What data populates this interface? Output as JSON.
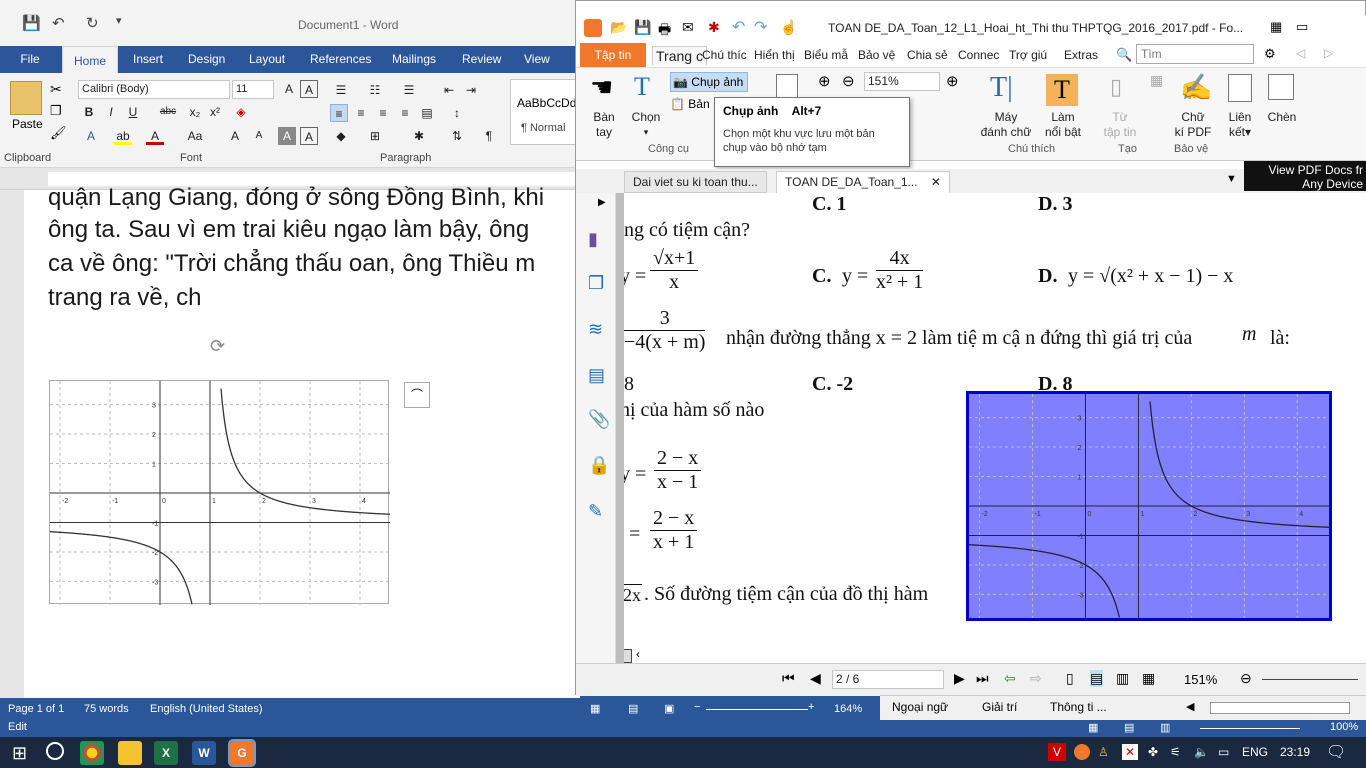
{
  "word": {
    "title": "Document1  -  Word",
    "tabs": [
      "File",
      "Home",
      "Insert",
      "Design",
      "Layout",
      "References",
      "Mailings",
      "Review",
      "View"
    ],
    "font_name": "Calibri (Body)",
    "font_size": "11",
    "style_preview": "AaBbCcDd",
    "style_name": "¶ Normal",
    "paste_label": "Paste",
    "groups": [
      "Clipboard",
      "Font",
      "Paragraph"
    ],
    "doc_lines": [
      "quận Lạng Giang, đóng ở sông Đồng Bình, khi",
      "ông ta. Sau vì em trai kiêu ngạo làm bậy, ông",
      "ca về ông: \"Trời chẳng thấu oan, ông Thiều m",
      "trang ra về, ch"
    ],
    "status": {
      "page": "Page 1 of 1",
      "words": "75 words",
      "lang": "English (United States)",
      "zoom": "164%"
    },
    "edit": "Edit"
  },
  "foxit": {
    "title": "TOAN DE_DA_Toan_12_L1_Hoai_ht_Thi thu THPTQG_2016_2017.pdf - Fo...",
    "tabs": [
      "Tập tin",
      "Trang c",
      "Chú thíc",
      "Hiển thị",
      "Biểu mẫ",
      "Bảo vệ",
      "Chia sẻ",
      "Connec",
      "Trợ giú",
      "Extras"
    ],
    "search_placeholder": "Tìm",
    "ribbon": {
      "hand": [
        "Bàn",
        "tay"
      ],
      "select": "Chọn",
      "snapshot": "Chụp ảnh",
      "clipboard": "Bản",
      "zoom": "151%",
      "typewriter": [
        "Máy",
        "đánh chữ"
      ],
      "highlight": [
        "Làm",
        "nổi bật"
      ],
      "fromfile": [
        "Từ",
        "tập tin"
      ],
      "sign": [
        "Chữ",
        "kí PDF"
      ],
      "link": [
        "Liên",
        "kết"
      ],
      "insert": "Chèn",
      "group_tools": "Công cụ",
      "group_comment": "Chú thích",
      "group_create": "Tạo",
      "group_protect": "Bảo vệ",
      "partial_letter": "ái"
    },
    "tooltip": {
      "title": "Chụp ảnh",
      "shortcut": "Alt+7",
      "desc": "Chọn một khu vực lưu một bản chụp vào bộ nhớ tạm"
    },
    "doc_tabs": [
      "Dai viet su ki toan thu...",
      "TOAN DE_DA_Toan_1..."
    ],
    "promo": [
      "View PDF Docs fr",
      "Any Device"
    ],
    "content": {
      "c1": "C. 1",
      "d1": "D. 3",
      "q2": "ng có tiệm cận?",
      "a2n": "√x+1",
      "a2d": "x",
      "c2": "C.",
      "c2y": "y =",
      "c2n": "4x",
      "c2d": "x² + 1",
      "d2": "D.",
      "d2f": "y = √(x² + x − 1) − x",
      "q3n": "3",
      "q3d": "−4(x + m)",
      "q3": "nhận đường thẳng  x = 2 làm tiệ m cậ n đứng thì giá trị của",
      "q3m": "m",
      "q3end": "là:",
      "b4": "8",
      "c4": "C. -2",
      "d4": "D. 8",
      "q5": "hị của hàm số nào",
      "y1n": "2 − x",
      "y1d": "x − 1",
      "y2n": "2 − x",
      "y2d": "x + 1",
      "q6": ". Số đường tiệm cận của đồ thị hàm",
      "q6d": "2x"
    },
    "nav": {
      "page": "2 / 6",
      "zoom": "151%"
    }
  },
  "tail": {
    "tabs": [
      "Ngoại ngữ",
      "Giải trí",
      "Thông ti ..."
    ],
    "zoom": "100%"
  },
  "graph_ticks": {
    "x": [
      "-2",
      "-1",
      "0",
      "1",
      "2",
      "3",
      "4"
    ],
    "y": [
      "3",
      "2",
      "1",
      "-1",
      "-2",
      "-3"
    ]
  },
  "taskbar": {
    "lang": "ENG",
    "time": "23:19"
  },
  "colors": {
    "word_blue": "#2b579a",
    "foxit_orange": "#f0782d",
    "snapshot_fill": "#8080ff",
    "snapshot_border": "#0000cc"
  }
}
